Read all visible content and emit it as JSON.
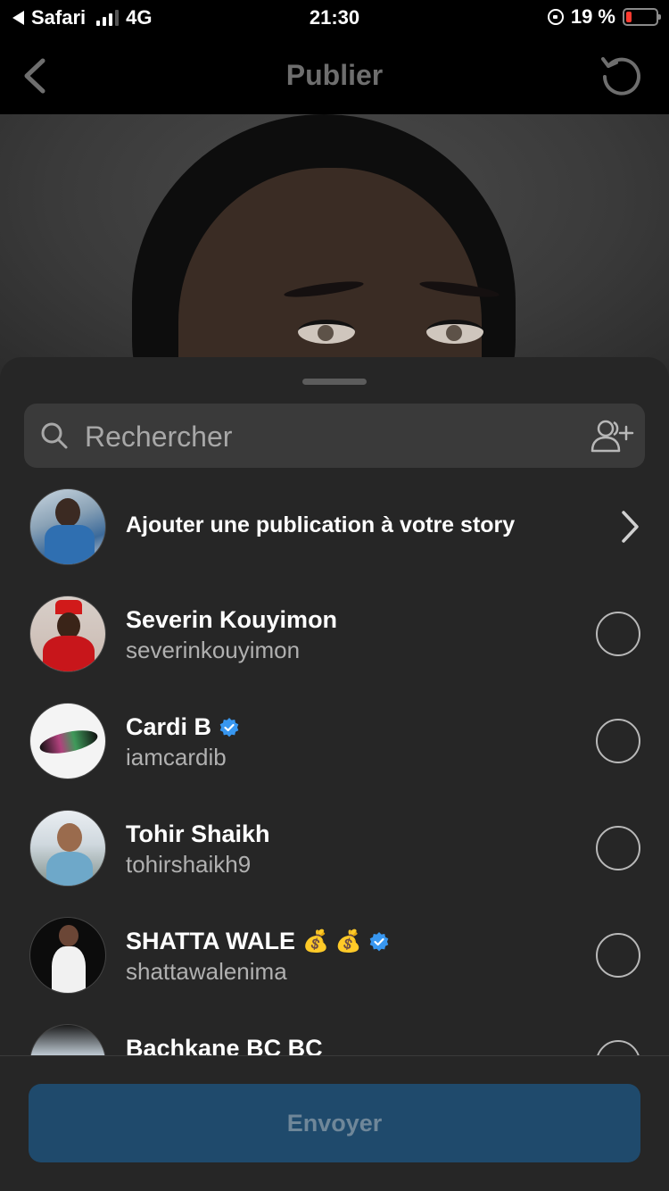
{
  "status_bar": {
    "back_app": "Safari",
    "network": "4G",
    "time": "21:30",
    "battery_percent": "19 %",
    "battery_level": 0.19,
    "battery_color": "#ff3b30"
  },
  "nav": {
    "title": "Publier",
    "back_icon": "chevron-left-icon",
    "refresh_icon": "refresh-icon"
  },
  "search": {
    "placeholder": "Rechercher",
    "add_people_icon": "add-people-icon"
  },
  "story_row": {
    "label": "Ajouter une publication à votre story"
  },
  "contacts": [
    {
      "name": "Severin Kouyimon",
      "username": "severinkouyimon",
      "verified": false,
      "emojis": ""
    },
    {
      "name": "Cardi B",
      "username": "iamcardib",
      "verified": true,
      "emojis": ""
    },
    {
      "name": "Tohir Shaikh",
      "username": "tohirshaikh9",
      "verified": false,
      "emojis": ""
    },
    {
      "name": "SHATTA WALE",
      "username": "shattawalenima",
      "verified": true,
      "emojis": "💰 💰"
    },
    {
      "name": "Bachkane BC BC",
      "username": "",
      "verified": false,
      "emojis": ""
    }
  ],
  "send_button": {
    "label": "Envoyer",
    "color": "#1f4a6c"
  },
  "colors": {
    "sheet_bg": "#262626",
    "search_bg": "#3a3a3a",
    "verified": "#3897f0"
  }
}
